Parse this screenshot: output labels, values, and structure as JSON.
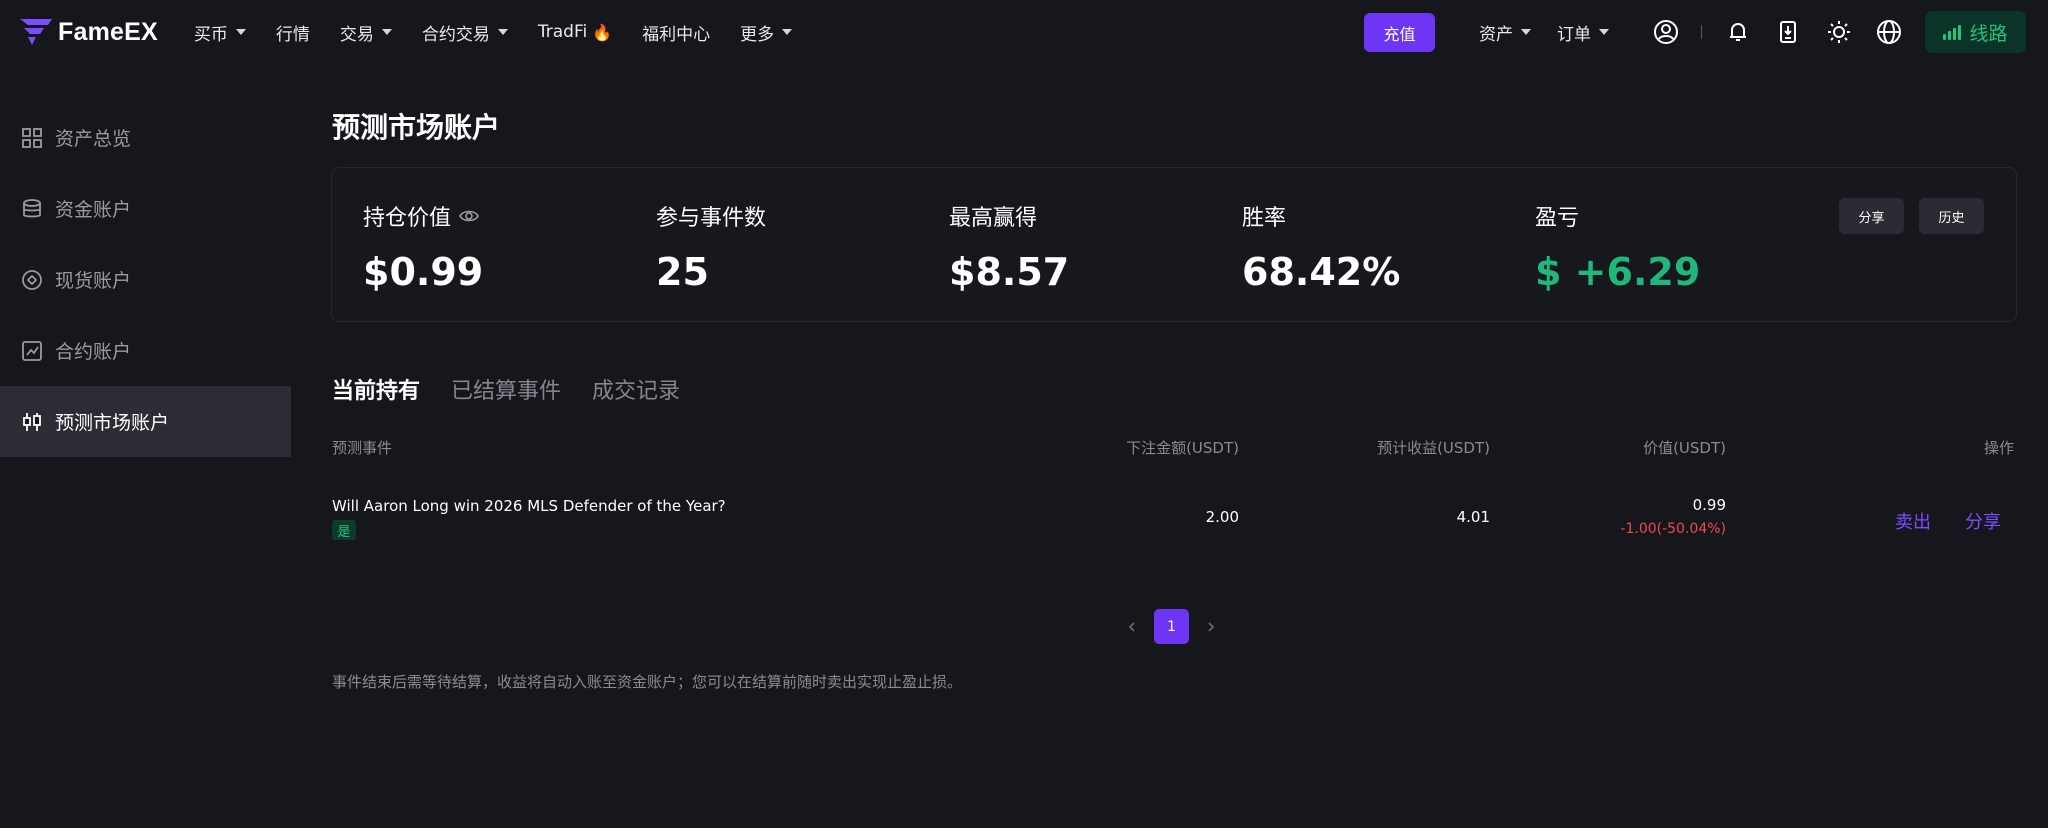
{
  "brand": {
    "name": "FameEX",
    "accent": "#6f35f5",
    "green": "#20b87a",
    "red": "#f04a4a"
  },
  "nav": {
    "items": [
      {
        "label": "买币",
        "dropdown": true
      },
      {
        "label": "行情",
        "dropdown": false
      },
      {
        "label": "交易",
        "dropdown": true
      },
      {
        "label": "合约交易",
        "dropdown": true
      },
      {
        "label": "TradFi",
        "dropdown": false,
        "icon": "flame-icon"
      },
      {
        "label": "福利中心",
        "dropdown": false
      },
      {
        "label": "更多",
        "dropdown": true
      }
    ],
    "deposit_label": "充值",
    "assets_label": "资产",
    "orders_label": "订单",
    "route_label": "线路",
    "icons": [
      "user-icon",
      "bell-icon",
      "download-icon",
      "theme-sun-icon",
      "globe-icon"
    ]
  },
  "sidebar": {
    "items": [
      {
        "label": "资产总览",
        "icon": "grid-icon",
        "active": false
      },
      {
        "label": "资金账户",
        "icon": "coins-icon",
        "active": false
      },
      {
        "label": "现货账户",
        "icon": "spot-icon",
        "active": false
      },
      {
        "label": "合约账户",
        "icon": "chart-icon",
        "active": false
      },
      {
        "label": "预测市场账户",
        "icon": "candlestick-icon",
        "active": true
      }
    ]
  },
  "page": {
    "title": "预测市场账户"
  },
  "summary": {
    "position_value": {
      "label": "持仓价值",
      "value": "$0.99"
    },
    "events_count": {
      "label": "参与事件数",
      "value": "25"
    },
    "max_win": {
      "label": "最高赢得",
      "value": "$8.57"
    },
    "win_rate": {
      "label": "胜率",
      "value": "68.42%"
    },
    "pnl": {
      "label": "盈亏",
      "value": "$ +6.29"
    },
    "share_label": "分享",
    "history_label": "历史"
  },
  "tabs": [
    {
      "label": "当前持有",
      "active": true
    },
    {
      "label": "已结算事件",
      "active": false
    },
    {
      "label": "成交记录",
      "active": false
    }
  ],
  "table": {
    "headers": {
      "event": "预测事件",
      "bet": "下注金额(USDT)",
      "expected": "预计收益(USDT)",
      "value": "价值(USDT)",
      "action": "操作"
    },
    "rows": [
      {
        "event": "Will Aaron Long win 2026 MLS Defender of the Year?",
        "side": "是",
        "bet": "2.00",
        "expected": "4.01",
        "value": "0.99",
        "change": "-1.00(-50.04%)",
        "sell_label": "卖出",
        "share_label": "分享"
      }
    ]
  },
  "pagination": {
    "current": "1"
  },
  "footnote": "事件结束后需等待结算，收益将自动入账至资金账户；您可以在结算前随时卖出实现止盈止损。"
}
